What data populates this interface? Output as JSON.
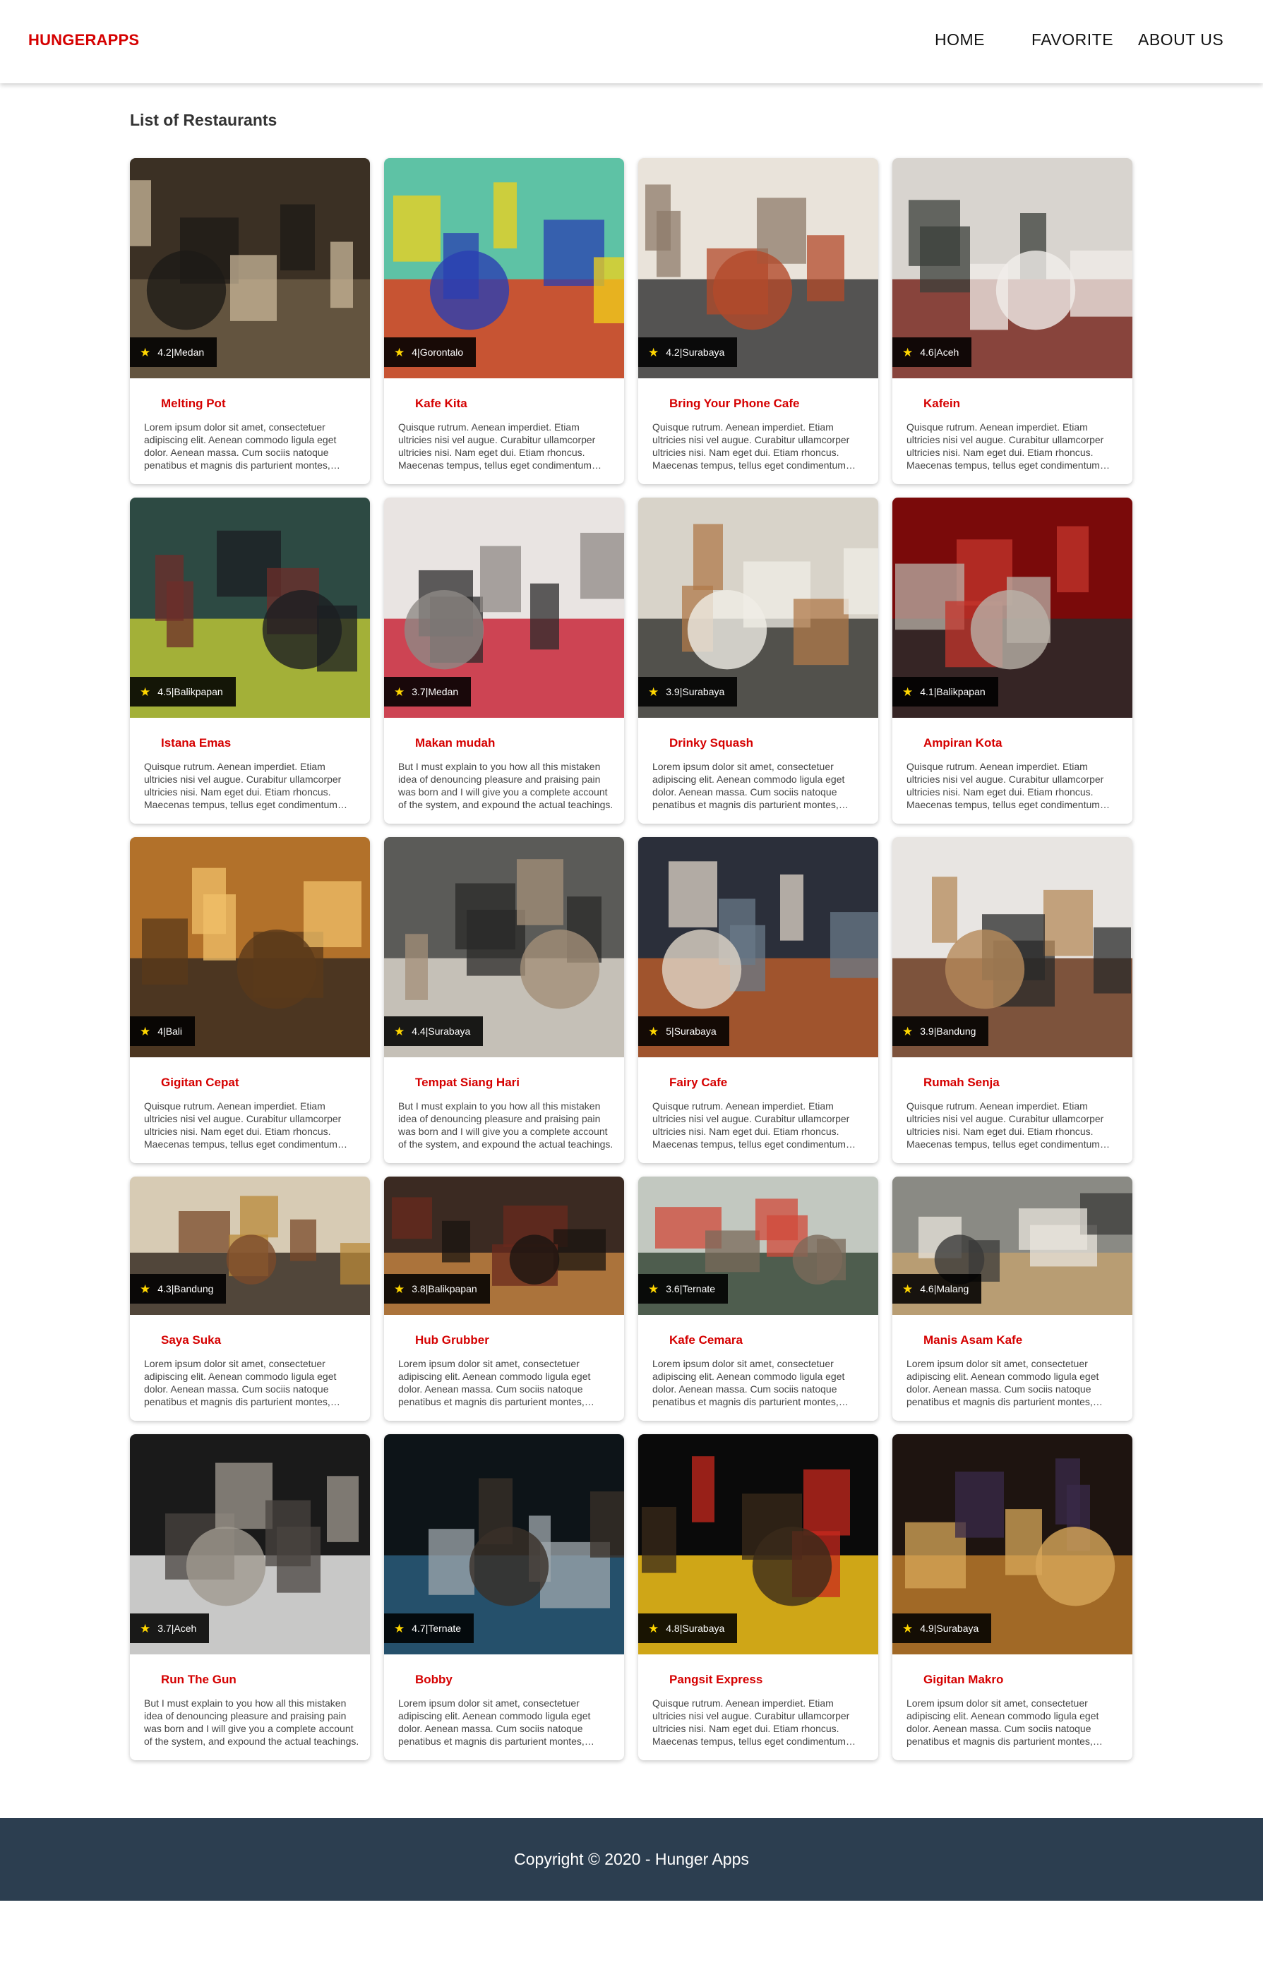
{
  "app": {
    "brand": "HUNGERAPPS"
  },
  "nav": {
    "home": "HOME",
    "favorite": "FAVORITE",
    "about": "ABOUT US"
  },
  "page": {
    "title": "List of Restaurants"
  },
  "colors": {
    "accent": "#d50000",
    "star": "#ffd600",
    "footer_bg": "#2c3e50"
  },
  "restaurants": [
    {
      "name": "Melting Pot",
      "rating": "4.2",
      "city": "Medan",
      "description": "Lorem ipsum dolor sit amet, consectetuer adipiscing elit. Aenean commodo ligula eget dolor. Aenean massa. Cum sociis natoque penatibus et magnis dis parturient montes, nascetur ridiculus mus."
    },
    {
      "name": "Kafe Kita",
      "rating": "4",
      "city": "Gorontalo",
      "description": "Quisque rutrum. Aenean imperdiet. Etiam ultricies nisi vel augue. Curabitur ullamcorper ultricies nisi. Nam eget dui. Etiam rhoncus. Maecenas tempus, tellus eget condimentum rhoncus."
    },
    {
      "name": "Bring Your Phone Cafe",
      "rating": "4.2",
      "city": "Surabaya",
      "description": "Quisque rutrum. Aenean imperdiet. Etiam ultricies nisi vel augue. Curabitur ullamcorper ultricies nisi. Nam eget dui. Etiam rhoncus. Maecenas tempus, tellus eget condimentum rhoncus."
    },
    {
      "name": "Kafein",
      "rating": "4.6",
      "city": "Aceh",
      "description": "Quisque rutrum. Aenean imperdiet. Etiam ultricies nisi vel augue. Curabitur ullamcorper ultricies nisi. Nam eget dui. Etiam rhoncus. Maecenas tempus, tellus eget condimentum rhoncus."
    },
    {
      "name": "Istana Emas",
      "rating": "4.5",
      "city": "Balikpapan",
      "description": "Quisque rutrum. Aenean imperdiet. Etiam ultricies nisi vel augue. Curabitur ullamcorper ultricies nisi. Nam eget dui. Etiam rhoncus. Maecenas tempus, tellus eget condimentum rhoncus."
    },
    {
      "name": "Makan mudah",
      "rating": "3.7",
      "city": "Medan",
      "description": "But I must explain to you how all this mistaken idea of denouncing pleasure and praising pain was born and I will give you a complete account of the system, and expound the actual teachings."
    },
    {
      "name": "Drinky Squash",
      "rating": "3.9",
      "city": "Surabaya",
      "description": "Lorem ipsum dolor sit amet, consectetuer adipiscing elit. Aenean commodo ligula eget dolor. Aenean massa. Cum sociis natoque penatibus et magnis dis parturient montes, nascetur ridiculus mus."
    },
    {
      "name": "Ampiran Kota",
      "rating": "4.1",
      "city": "Balikpapan",
      "description": "Quisque rutrum. Aenean imperdiet. Etiam ultricies nisi vel augue. Curabitur ullamcorper ultricies nisi. Nam eget dui. Etiam rhoncus. Maecenas tempus, tellus eget condimentum rhoncus."
    },
    {
      "name": "Gigitan Cepat",
      "rating": "4",
      "city": "Bali",
      "description": "Quisque rutrum. Aenean imperdiet. Etiam ultricies nisi vel augue. Curabitur ullamcorper ultricies nisi. Nam eget dui. Etiam rhoncus. Maecenas tempus, tellus eget condimentum rhoncus."
    },
    {
      "name": "Tempat Siang Hari",
      "rating": "4.4",
      "city": "Surabaya",
      "description": "But I must explain to you how all this mistaken idea of denouncing pleasure and praising pain was born and I will give you a complete account of the system, and expound the actual teachings."
    },
    {
      "name": "Fairy Cafe",
      "rating": "5",
      "city": "Surabaya",
      "description": "Quisque rutrum. Aenean imperdiet. Etiam ultricies nisi vel augue. Curabitur ullamcorper ultricies nisi. Nam eget dui. Etiam rhoncus. Maecenas tempus, tellus eget condimentum rhoncus."
    },
    {
      "name": "Rumah Senja",
      "rating": "3.9",
      "city": "Bandung",
      "description": "Quisque rutrum. Aenean imperdiet. Etiam ultricies nisi vel augue. Curabitur ullamcorper ultricies nisi. Nam eget dui. Etiam rhoncus. Maecenas tempus, tellus eget condimentum rhoncus."
    },
    {
      "name": "Saya Suka",
      "rating": "4.3",
      "city": "Bandung",
      "description": "Lorem ipsum dolor sit amet, consectetuer adipiscing elit. Aenean commodo ligula eget dolor. Aenean massa. Cum sociis natoque penatibus et magnis dis parturient montes, nascetur ridiculus mus."
    },
    {
      "name": "Hub Grubber",
      "rating": "3.8",
      "city": "Balikpapan",
      "description": "Lorem ipsum dolor sit amet, consectetuer adipiscing elit. Aenean commodo ligula eget dolor. Aenean massa. Cum sociis natoque penatibus et magnis dis parturient montes, nascetur ridiculus mus."
    },
    {
      "name": "Kafe Cemara",
      "rating": "3.6",
      "city": "Ternate",
      "description": "Lorem ipsum dolor sit amet, consectetuer adipiscing elit. Aenean commodo ligula eget dolor. Aenean massa. Cum sociis natoque penatibus et magnis dis parturient montes, nascetur ridiculus mus."
    },
    {
      "name": "Manis Asam Kafe",
      "rating": "4.6",
      "city": "Malang",
      "description": "Lorem ipsum dolor sit amet, consectetuer adipiscing elit. Aenean commodo ligula eget dolor. Aenean massa. Cum sociis natoque penatibus et magnis dis parturient montes, nascetur ridiculus mus."
    },
    {
      "name": "Run The Gun",
      "rating": "3.7",
      "city": "Aceh",
      "description": "But I must explain to you how all this mistaken idea of denouncing pleasure and praising pain was born and I will give you a complete account of the system, and expound the actual teachings."
    },
    {
      "name": "Bobby",
      "rating": "4.7",
      "city": "Ternate",
      "description": "Lorem ipsum dolor sit amet, consectetuer adipiscing elit. Aenean commodo ligula eget dolor. Aenean massa. Cum sociis natoque penatibus et magnis dis parturient montes, nascetur ridiculus mus."
    },
    {
      "name": "Pangsit Express",
      "rating": "4.8",
      "city": "Surabaya",
      "description": "Quisque rutrum. Aenean imperdiet. Etiam ultricies nisi vel augue. Curabitur ullamcorper ultricies nisi. Nam eget dui. Etiam rhoncus. Maecenas tempus, tellus eget condimentum rhoncus."
    },
    {
      "name": "Gigitan Makro",
      "rating": "4.9",
      "city": "Surabaya",
      "description": "Lorem ipsum dolor sit amet, consectetuer adipiscing elit. Aenean commodo ligula eget dolor. Aenean massa. Cum sociis natoque penatibus et magnis dis parturient montes, nascetur ridiculus mus."
    }
  ],
  "footer": {
    "copyright": "Copyright © 2020 - Hunger Apps"
  }
}
